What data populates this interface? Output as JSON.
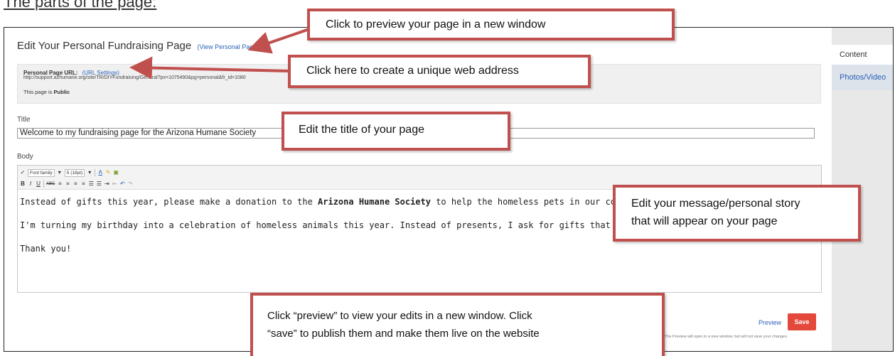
{
  "heading": "The parts of the page:",
  "page": {
    "title": "Edit Your Personal Fundraising Page",
    "view_link": "(View Personal Page)"
  },
  "url_box": {
    "label": "Personal Page URL:",
    "settings_link": "(URL Settings)",
    "url": "http://support.azhumane.org/site/TR/DIYFundraising/General?px=1075490&pg=personal&fr_id=1080",
    "status_prefix": "This page is",
    "status": "Public"
  },
  "title_field": {
    "label": "Title",
    "value": "Welcome to my fundraising page for the Arizona Humane Society"
  },
  "body_field": {
    "label": "Body",
    "toolbar": {
      "font_family": "Font family",
      "font_size": "5 (18pt)"
    },
    "paragraph1_before": "Instead of gifts this year, please make a donation to the ",
    "paragraph1_bold": "Arizona Humane Society",
    "paragraph1_after": " to help the homeless pets in our community!",
    "paragraph2": "I'm turning my birthday into a celebration of homeless animals this year. Instead of presents, I ask for gifts that give back.",
    "paragraph3": "Thank you!"
  },
  "side_tabs": [
    "Content",
    "Photos/Video"
  ],
  "actions": {
    "preview": "Preview",
    "save": "Save",
    "note": "The Preview will open in a new window, but will not save your changes."
  },
  "callouts": {
    "preview_page": "Click to preview your page in a new window",
    "unique_url": "Click here to create a unique web address",
    "edit_title": "Edit the title of your page",
    "edit_message_line1": "Edit your message/personal story",
    "edit_message_line2": "that will appear on your page",
    "save_line1": "Click “preview” to view your edits in a new window. Click",
    "save_line2": "“save” to publish them and make them live on the website"
  },
  "colors": {
    "callout_border": "#c0504d",
    "link": "#2b62b8",
    "save_button": "#e4483a"
  }
}
